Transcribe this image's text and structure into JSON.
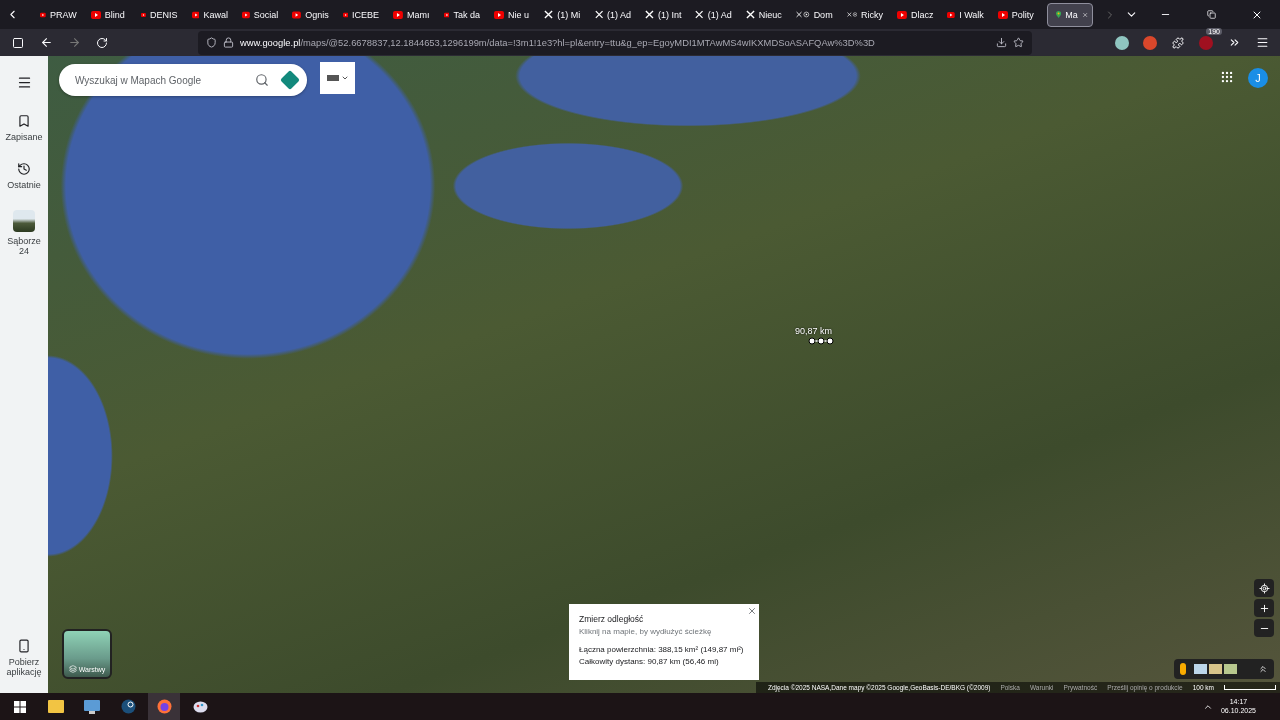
{
  "tabs": [
    {
      "label": "PRAW",
      "kind": "youtube",
      "selected": false
    },
    {
      "label": "Blind",
      "kind": "youtube",
      "selected": false
    },
    {
      "label": "DENIS",
      "kind": "youtube",
      "selected": false
    },
    {
      "label": "Kawal",
      "kind": "youtube",
      "selected": false
    },
    {
      "label": "Social",
      "kind": "youtube",
      "selected": false
    },
    {
      "label": "Ognis",
      "kind": "youtube",
      "selected": false
    },
    {
      "label": "ICEBE",
      "kind": "youtube",
      "selected": false
    },
    {
      "label": "Mamı",
      "kind": "youtube",
      "selected": false
    },
    {
      "label": "Tak da",
      "kind": "youtube",
      "selected": false
    },
    {
      "label": "Nie u",
      "kind": "youtube",
      "selected": false
    },
    {
      "label": "(1) Mi",
      "kind": "x",
      "selected": false
    },
    {
      "label": "(1) Ad",
      "kind": "x",
      "selected": false
    },
    {
      "label": "(1) Int",
      "kind": "x",
      "selected": false
    },
    {
      "label": "(1) Ad",
      "kind": "x",
      "selected": false
    },
    {
      "label": "Nieuc",
      "kind": "x",
      "selected": false
    },
    {
      "label": "Dom",
      "kind": "x-play",
      "selected": false
    },
    {
      "label": "Ricky",
      "kind": "x-play",
      "selected": false
    },
    {
      "label": "Dlacz",
      "kind": "youtube",
      "selected": false
    },
    {
      "label": "I Walk",
      "kind": "youtube",
      "selected": false
    },
    {
      "label": "Polity",
      "kind": "youtube",
      "selected": false
    },
    {
      "label": "Ma",
      "kind": "maps",
      "selected": true
    }
  ],
  "address": {
    "host": "www.google.pl",
    "path": "/maps/@52.6678837,12.1844653,1296199m/data=!3m1!1e3?hl=pl&entry=ttu&g_ep=EgoyMDI1MTAwMS4wIKXMDSoASAFQAw%3D%3D"
  },
  "extension_badge": "190",
  "sidebar": {
    "items": [
      {
        "label": "Zapisane",
        "kind": "bookmark"
      },
      {
        "label": "Ostatnie",
        "kind": "history"
      },
      {
        "label": "Sąborze 24",
        "kind": "thumbnail"
      }
    ],
    "footer": "Pobierz aplikację"
  },
  "search": {
    "placeholder": "Wyszukaj w Mapach Google"
  },
  "avatar": "J",
  "layers": "Warstwy",
  "measure_label": "90,87 km",
  "measure_popup": {
    "title": "Zmierz odległość",
    "hint": "Kliknij na mapie, by wydłużyć ścieżkę",
    "area": "Łączna powierzchnia: 388,15 km² (149,87 mi²)",
    "distance": "Całkowity dystans: 90,87 km (56,46 mi)"
  },
  "attribution": [
    "Zdjęcia ©2025 NASA,Dane mapy ©2025 Google,GeoBasis-DE/BKG (©2009)",
    "Polska",
    "Warunki",
    "Prywatność",
    "Prześlij opinię o produkcie"
  ],
  "scale": "100 km",
  "clock": {
    "time": "14:17",
    "date": "06.10.2025"
  }
}
